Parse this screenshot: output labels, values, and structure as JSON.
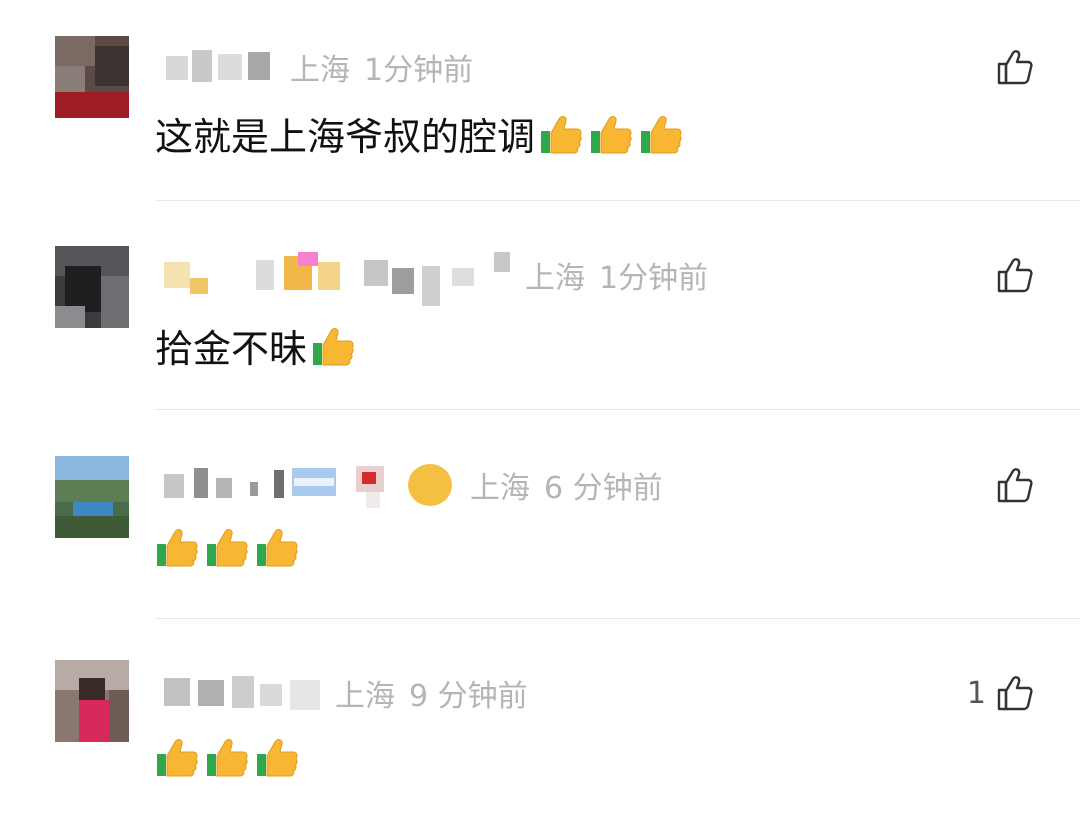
{
  "comments": [
    {
      "location": "上海",
      "time": "1分钟前",
      "text": "这就是上海爷叔的腔调",
      "emojis": [
        "thumbs-up",
        "thumbs-up",
        "thumbs-up"
      ],
      "likes": ""
    },
    {
      "location": "上海",
      "time": "1分钟前",
      "text": "拾金不昧",
      "emojis": [
        "thumbs-up"
      ],
      "likes": ""
    },
    {
      "location": "上海",
      "time": "6 分钟前",
      "text": "",
      "emojis": [
        "thumbs-up",
        "thumbs-up",
        "thumbs-up"
      ],
      "likes": ""
    },
    {
      "location": "上海",
      "time": "9 分钟前",
      "text": "",
      "emojis": [
        "thumbs-up",
        "thumbs-up",
        "thumbs-up"
      ],
      "likes": "1"
    }
  ],
  "icons": {
    "like": "thumbs-up-outline-icon",
    "emoji": "thumbs-up-emoji"
  },
  "colors": {
    "meta_gray": "#b5b5b5",
    "divider": "#e9e9e9",
    "emoji_yellow": "#f7b733",
    "emoji_cuff": "#2ea84a"
  }
}
